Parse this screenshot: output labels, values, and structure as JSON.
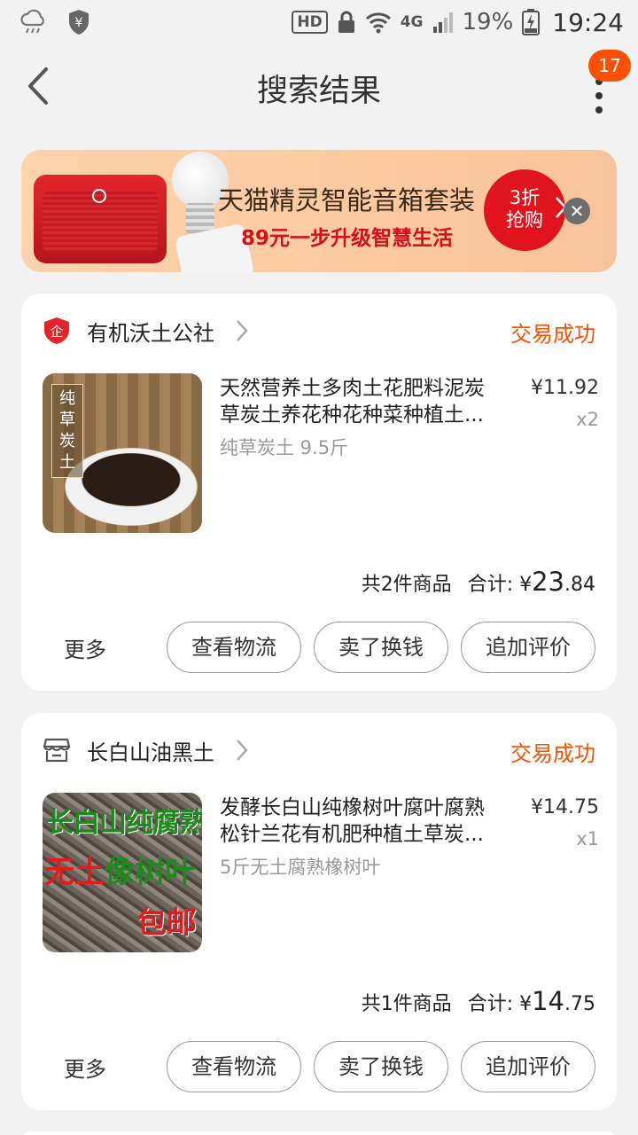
{
  "status_bar": {
    "network_badge": "HD",
    "signal_label": "4G",
    "battery": "19%",
    "time": "19:24"
  },
  "header": {
    "title": "搜索结果",
    "badge_count": "17"
  },
  "banner": {
    "title": "天猫精灵智能音箱套装",
    "subtitle": "89元一步升级智慧生活",
    "cta_line1": "3折",
    "cta_line2": "抢购",
    "close_symbol": "✕"
  },
  "orders": [
    {
      "shop_name": "有机沃土公社",
      "shop_icon": "enterprise-shield-icon",
      "status": "交易成功",
      "item_title": "天然营养土多肉土花肥料泥炭草炭土养花种花种菜种植土...",
      "item_sku": "纯草炭土 9.5斤",
      "item_price": "¥11.92",
      "item_qty": "x2",
      "thumb_tag": "纯草炭土",
      "summary_count": "共2件商品",
      "summary_label": "合计: ¥",
      "summary_int": "23",
      "summary_dec": ".84",
      "more": "更多",
      "btn_logistics": "查看物流",
      "btn_resell": "卖了换钱",
      "btn_review": "追加评价"
    },
    {
      "shop_name": "长白山油黑土",
      "shop_icon": "store-icon",
      "status": "交易成功",
      "item_title": "发酵长白山纯橡树叶腐叶腐熟松针兰花有机肥种植土草炭...",
      "item_sku": "5斤无土腐熟橡树叶",
      "item_price": "¥14.75",
      "item_qty": "x1",
      "thumb_line1": "长白山纯腐熟",
      "thumb_line2_red": "无土",
      "thumb_line2_green": "像树叶",
      "thumb_line3": "包邮",
      "summary_count": "共1件商品",
      "summary_label": "合计: ¥",
      "summary_int": "14",
      "summary_dec": ".75",
      "more": "更多",
      "btn_logistics": "查看物流",
      "btn_resell": "卖了换钱",
      "btn_review": "追加评价"
    }
  ],
  "colors": {
    "accent": "#ff5000",
    "background": "#f2f2f2",
    "banner_red": "#e1141e"
  }
}
